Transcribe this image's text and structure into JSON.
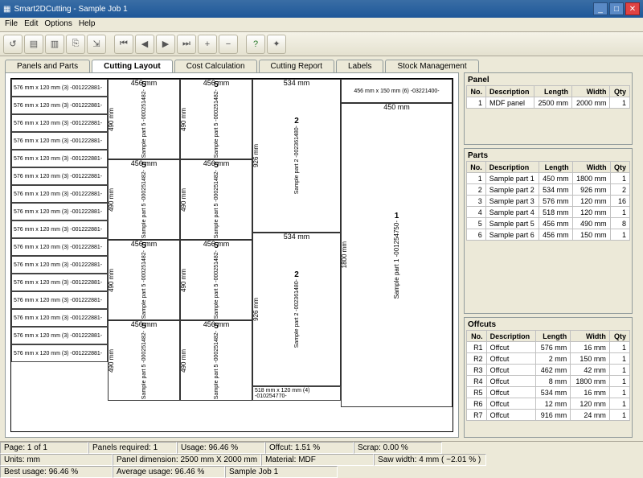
{
  "window": {
    "title": "Smart2DCutting - Sample Job 1"
  },
  "menu": [
    "File",
    "Edit",
    "Options",
    "Help"
  ],
  "tabs": {
    "items": [
      "Panels and Parts",
      "Cutting Layout",
      "Cost Calculation",
      "Cutting Report",
      "Labels",
      "Stock Management"
    ],
    "active": 1
  },
  "panel_table": {
    "title": "Panel",
    "headers": [
      "No.",
      "Description",
      "Length",
      "Width",
      "Qty"
    ],
    "rows": [
      [
        "1",
        "MDF panel",
        "2500 mm",
        "2000 mm",
        "1"
      ]
    ]
  },
  "parts_table": {
    "title": "Parts",
    "headers": [
      "No.",
      "Description",
      "Length",
      "Width",
      "Qty"
    ],
    "rows": [
      [
        "1",
        "Sample part 1",
        "450 mm",
        "1800 mm",
        "1"
      ],
      [
        "2",
        "Sample part 2",
        "534 mm",
        "926 mm",
        "2"
      ],
      [
        "3",
        "Sample part 3",
        "576 mm",
        "120 mm",
        "16"
      ],
      [
        "4",
        "Sample part 4",
        "518 mm",
        "120 mm",
        "1"
      ],
      [
        "5",
        "Sample part 5",
        "456 mm",
        "490 mm",
        "8"
      ],
      [
        "6",
        "Sample part 6",
        "456 mm",
        "150 mm",
        "1"
      ]
    ]
  },
  "offcuts_table": {
    "title": "Offcuts",
    "headers": [
      "No.",
      "Description",
      "Length",
      "Width",
      "Qty"
    ],
    "rows": [
      [
        "R1",
        "Offcut",
        "576 mm",
        "16 mm",
        "1"
      ],
      [
        "R2",
        "Offcut",
        "2 mm",
        "150 mm",
        "1"
      ],
      [
        "R3",
        "Offcut",
        "462 mm",
        "42 mm",
        "1"
      ],
      [
        "R4",
        "Offcut",
        "8 mm",
        "1800 mm",
        "1"
      ],
      [
        "R5",
        "Offcut",
        "534 mm",
        "16 mm",
        "1"
      ],
      [
        "R6",
        "Offcut",
        "12 mm",
        "120 mm",
        "1"
      ],
      [
        "R7",
        "Offcut",
        "916 mm",
        "24 mm",
        "1"
      ]
    ]
  },
  "status": {
    "row1": [
      "Page: 1 of 1",
      "Panels required: 1",
      "Usage: 96.46 %",
      "Offcut: 1.51 %",
      "Scrap: 0.00 %"
    ],
    "row2": [
      "Units: mm",
      "Panel dimension: 2500 mm X 2000 mm",
      "Material: MDF",
      "Saw width: 4 mm   ( ~2.01 % )"
    ],
    "row3": [
      "Best usage: 96.46 %",
      "Average usage: 96.46 %",
      "Sample Job 1"
    ]
  },
  "layout": {
    "strip_label": "576 mm x 120 mm (3)  -001222881-",
    "p5_dim": "456 mm",
    "p5_height": "490 mm",
    "p5_num": "5",
    "p5_label": "Sample part 5 -000251482-",
    "p2_dim": "534 mm",
    "p2_height": "926 mm",
    "p2_num": "2",
    "p2_label": "Sample part 2  -002361480-",
    "p1_dim": "450 mm",
    "p1_height": "1800 mm",
    "p1_num": "1",
    "p1_label": "Sample part 1  -001254750-",
    "p6_label": "456 mm x 150 mm (6) -03221400-",
    "p4_label": "518 mm x 120 mm (4)  -010254770-"
  }
}
